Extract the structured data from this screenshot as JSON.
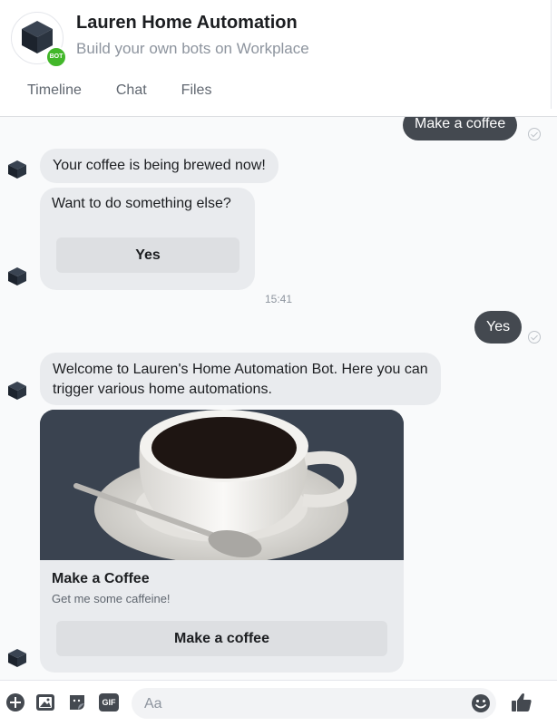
{
  "header": {
    "title": "Lauren Home Automation",
    "subtitle": "Build your own bots on Workplace",
    "badge": "BOT",
    "tabs": [
      "Timeline",
      "Chat",
      "Files"
    ]
  },
  "messages": {
    "user_1": "Make a coffee",
    "bot_1": "Your coffee is being brewed now!",
    "bot_2": "Want to do something else?",
    "bot_2_button": "Yes",
    "timestamp": "15:41",
    "user_2": "Yes",
    "bot_3": "Welcome to Lauren's Home Automation Bot.  Here you can trigger various home automations."
  },
  "card": {
    "title": "Make a Coffee",
    "subtitle": "Get me some caffeine!",
    "button": "Make a coffee"
  },
  "composer": {
    "placeholder": "Aa",
    "gif_label": "GIF"
  },
  "colors": {
    "user_bubble": "#444950",
    "bot_bubble": "#e9ebee",
    "bot_badge": "#42b72a"
  }
}
